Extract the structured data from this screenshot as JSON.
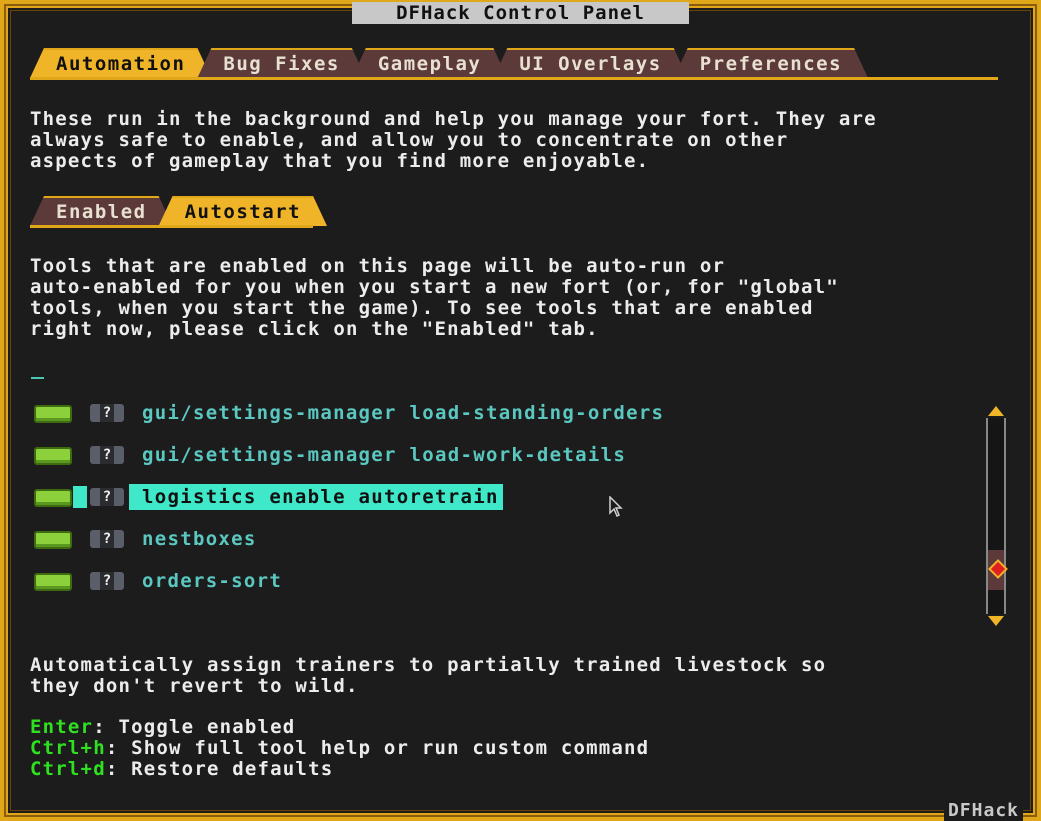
{
  "window": {
    "title": "DFHack Control Panel",
    "brand": "DFHack"
  },
  "main_tabs": [
    {
      "label": "Automation",
      "active": true
    },
    {
      "label": "Bug Fixes",
      "active": false
    },
    {
      "label": "Gameplay",
      "active": false
    },
    {
      "label": "UI Overlays",
      "active": false
    },
    {
      "label": "Preferences",
      "active": false
    }
  ],
  "intro_text": "These run in the background and help you manage your fort. They are\nalways safe to enable, and allow you to concentrate on other\naspects of gameplay that you find more enjoyable.",
  "sub_tabs": [
    {
      "label": "Enabled",
      "active": false
    },
    {
      "label": "Autostart",
      "active": true
    }
  ],
  "autostart_text": "Tools that are enabled on this page will be auto-run or\nauto-enabled for you when you start a new fort (or, for \"global\"\ntools, when you start the game). To see tools that are enabled\nright now, please click on the \"Enabled\" tab.",
  "filter": {
    "value": ""
  },
  "tools": [
    {
      "name": "gui/settings-manager load-standing-orders",
      "enabled": true,
      "help": "?",
      "selected": false
    },
    {
      "name": "gui/settings-manager load-work-details",
      "enabled": true,
      "help": "?",
      "selected": false
    },
    {
      "name": "logistics enable autoretrain",
      "enabled": true,
      "help": "?",
      "selected": true
    },
    {
      "name": "nestboxes",
      "enabled": true,
      "help": "?",
      "selected": false
    },
    {
      "name": "orders-sort",
      "enabled": true,
      "help": "?",
      "selected": false
    }
  ],
  "scrollbar": {
    "position": 0.82
  },
  "selected_description": "Automatically assign trainers to partially trained livestock so\nthey don't revert to wild.",
  "hotkeys": [
    {
      "key": "Enter",
      "desc": "Toggle enabled"
    },
    {
      "key": "Ctrl+h",
      "desc": "Show full tool help or run custom command"
    },
    {
      "key": "Ctrl+d",
      "desc": "Restore defaults"
    }
  ],
  "colors": {
    "frame": "#e0a818",
    "tab_active": "#f0b428",
    "tab_inactive": "#5c3a3a",
    "tool_name": "#5ac8c0",
    "selection": "#3ee8c8",
    "hotkey": "#2ee020",
    "toggle_on": "#8cd03c"
  }
}
